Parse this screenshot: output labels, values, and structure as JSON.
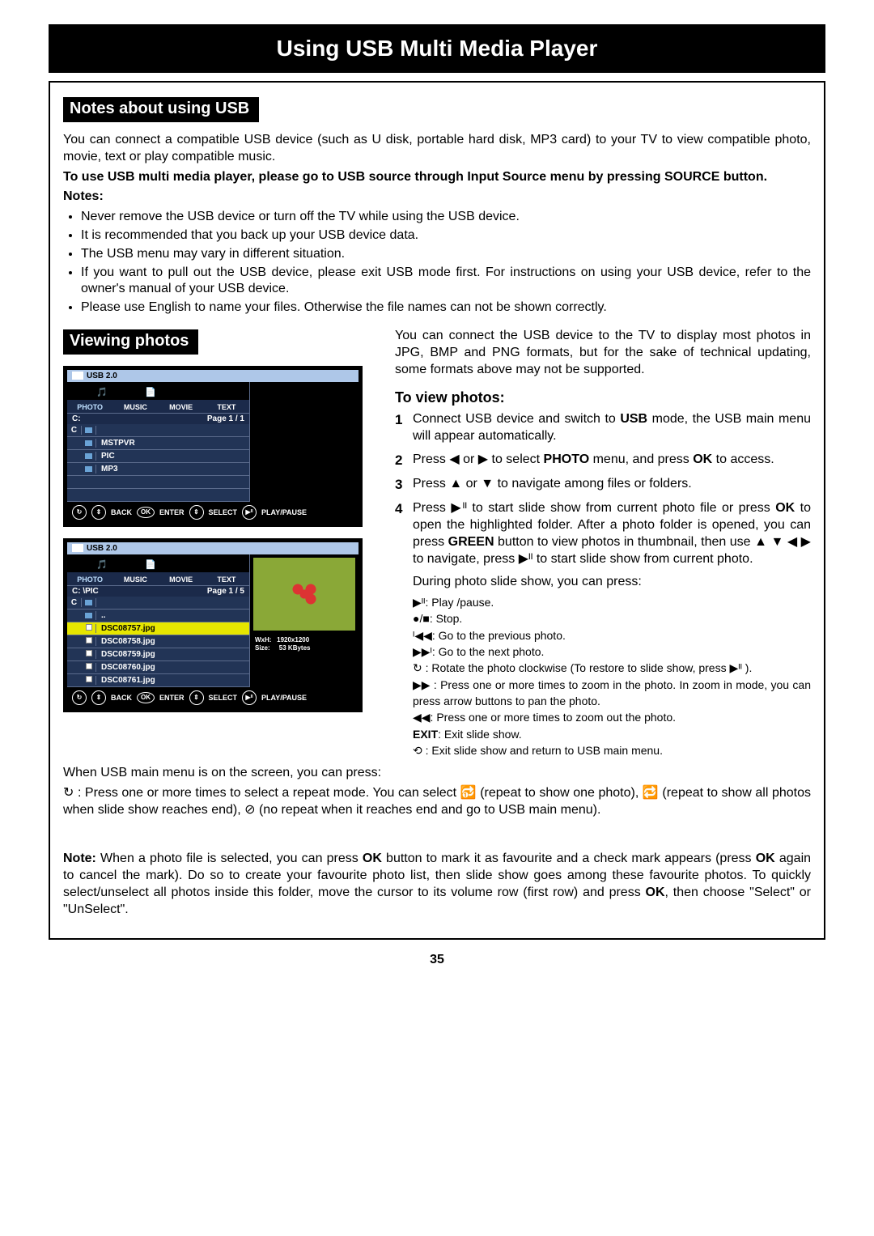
{
  "page": {
    "title": "Using USB Multi Media Player",
    "pageNumber": "35"
  },
  "notesSection": {
    "heading": "Notes about using USB",
    "intro": "You can connect a compatible USB device (such as U disk, portable hard disk, MP3 card) to your TV to view compatible photo, movie, text or play compatible music.",
    "boldLine": "To use USB multi media player, please go to USB source through Input Source menu by pressing SOURCE button.",
    "notesLabel": "Notes:",
    "bullets": [
      "Never remove the USB device or turn off the TV while using the USB device.",
      "It is recommended that you back up your USB device data.",
      "The USB menu may vary in different situation.",
      "If you want to pull out the USB device, please exit USB mode first.  For instructions on using your USB device, refer to the owner's manual of your USB device.",
      "Please use English to name your files. Otherwise the file names can not be shown correctly."
    ]
  },
  "viewingSection": {
    "heading": "Viewing photos",
    "rightIntro": "You can connect the USB device to the TV to display most photos in JPG, BMP and PNG formats, but for the sake of technical updating, some formats above may not be supported.",
    "subHeading": "To view photos:",
    "steps": [
      {
        "n": "1",
        "t": "Connect USB device and switch to ",
        "b": "USB",
        "t2": " mode, the USB main menu will appear automatically."
      },
      {
        "n": "2",
        "t": "Press ◀ or ▶ to select ",
        "b": "PHOTO",
        "t2": " menu, and press ",
        "b2": "OK",
        "t3": " to access."
      },
      {
        "n": "3",
        "t": "Press ▲ or ▼ to navigate among files or folders."
      },
      {
        "n": "4",
        "t": "Press ▶ᴵᴵ to start slide show from current photo file or press ",
        "b": "OK",
        "t2": " to open the highlighted folder. After a photo folder is opened, you can press ",
        "b2": "GREEN",
        "t3": " button to view photos in thumbnail, then use ▲ ▼ ◀ ▶ to navigate, press ▶ᴵᴵ to start slide show from current photo."
      }
    ],
    "duringLine": "During photo slide show, you can press:",
    "controls": [
      {
        "sym": "▶ᴵᴵ",
        "txt": ": Play /pause."
      },
      {
        "sym": "●/■",
        "txt": ": Stop."
      },
      {
        "sym": "ᴵ◀◀",
        "txt": ": Go to the previous photo."
      },
      {
        "sym": "▶▶ᴵ",
        "txt": ": Go to the next photo."
      },
      {
        "sym": "↻",
        "txt": " : Rotate the photo clockwise (To restore to slide show, press ▶ᴵᴵ )."
      },
      {
        "sym": "▶▶",
        "txt": " : Press one or more times to zoom in the photo.   In zoom in mode, you can press arrow buttons to pan the photo."
      },
      {
        "sym": "◀◀",
        "txt": ": Press one or more times to zoom out the photo."
      },
      {
        "sym": "EXIT",
        "txt": ": Exit slide show.",
        "bold": true
      },
      {
        "sym": "⟲",
        "txt": " : Exit slide show and return to USB main menu."
      }
    ]
  },
  "osd1": {
    "usbLabel": "USB 2.0",
    "tabs": [
      "PHOTO",
      "MUSIC",
      "MOVIE",
      "TEXT"
    ],
    "path": "C:",
    "page": "Page 1 / 1",
    "rows": [
      {
        "a": "C",
        "b": "folder",
        "name": ""
      },
      {
        "a": "",
        "b": "folder",
        "name": "MSTPVR"
      },
      {
        "a": "",
        "b": "folder",
        "name": "PIC"
      },
      {
        "a": "",
        "b": "folder",
        "name": "MP3"
      },
      {
        "a": "",
        "b": "",
        "name": ""
      },
      {
        "a": "",
        "b": "",
        "name": ""
      }
    ],
    "footer": {
      "back": "BACK",
      "ok": "OK",
      "enter": "ENTER",
      "select": "SELECT",
      "pp": "PLAY/PAUSE"
    }
  },
  "osd2": {
    "usbLabel": "USB 2.0",
    "tabs": [
      "PHOTO",
      "MUSIC",
      "MOVIE",
      "TEXT"
    ],
    "path": "C:   \\PIC",
    "page": "Page 1 / 5",
    "rows": [
      {
        "a": "C",
        "b": "folder",
        "name": ""
      },
      {
        "a": "",
        "b": "folder",
        "name": ".."
      },
      {
        "a": "",
        "b": "img",
        "name": "DSC08757.jpg",
        "sel": true
      },
      {
        "a": "",
        "b": "img",
        "name": "DSC08758.jpg"
      },
      {
        "a": "",
        "b": "img",
        "name": "DSC08759.jpg"
      },
      {
        "a": "",
        "b": "img",
        "name": "DSC08760.jpg"
      },
      {
        "a": "",
        "b": "img",
        "name": "DSC08761.jpg"
      }
    ],
    "info": {
      "wxhLabel": "WxH:",
      "wxh": "1920x1200",
      "sizeLabel": "Size:",
      "size": "53 KBytes"
    },
    "footer": {
      "back": "BACK",
      "ok": "OK",
      "enter": "ENTER",
      "select": "SELECT",
      "pp": "PLAY/PAUSE"
    }
  },
  "bottom": {
    "intro": "When USB main menu is on the screen, you can press:",
    "repeat": "↻ : Press one or more times to select a repeat mode. You can select 🔂 (repeat to show one photo), 🔁 (repeat to show all photos when slide show reaches end), ⊘ (no repeat when it reaches end and go to USB main menu).",
    "noteLabel": "Note:",
    "note": " When a photo file is selected, you can press ",
    "ok": "OK",
    "note2": " button to mark it as favourite and a check mark appears (press ",
    "note3": " again to cancel the mark). Do so to create your favourite photo list, then slide show goes among these favourite photos. To quickly select/unselect all photos inside this folder, move the cursor to its volume row (first row) and press ",
    "note4": ", then choose \"Select\" or \"UnSelect\"."
  }
}
